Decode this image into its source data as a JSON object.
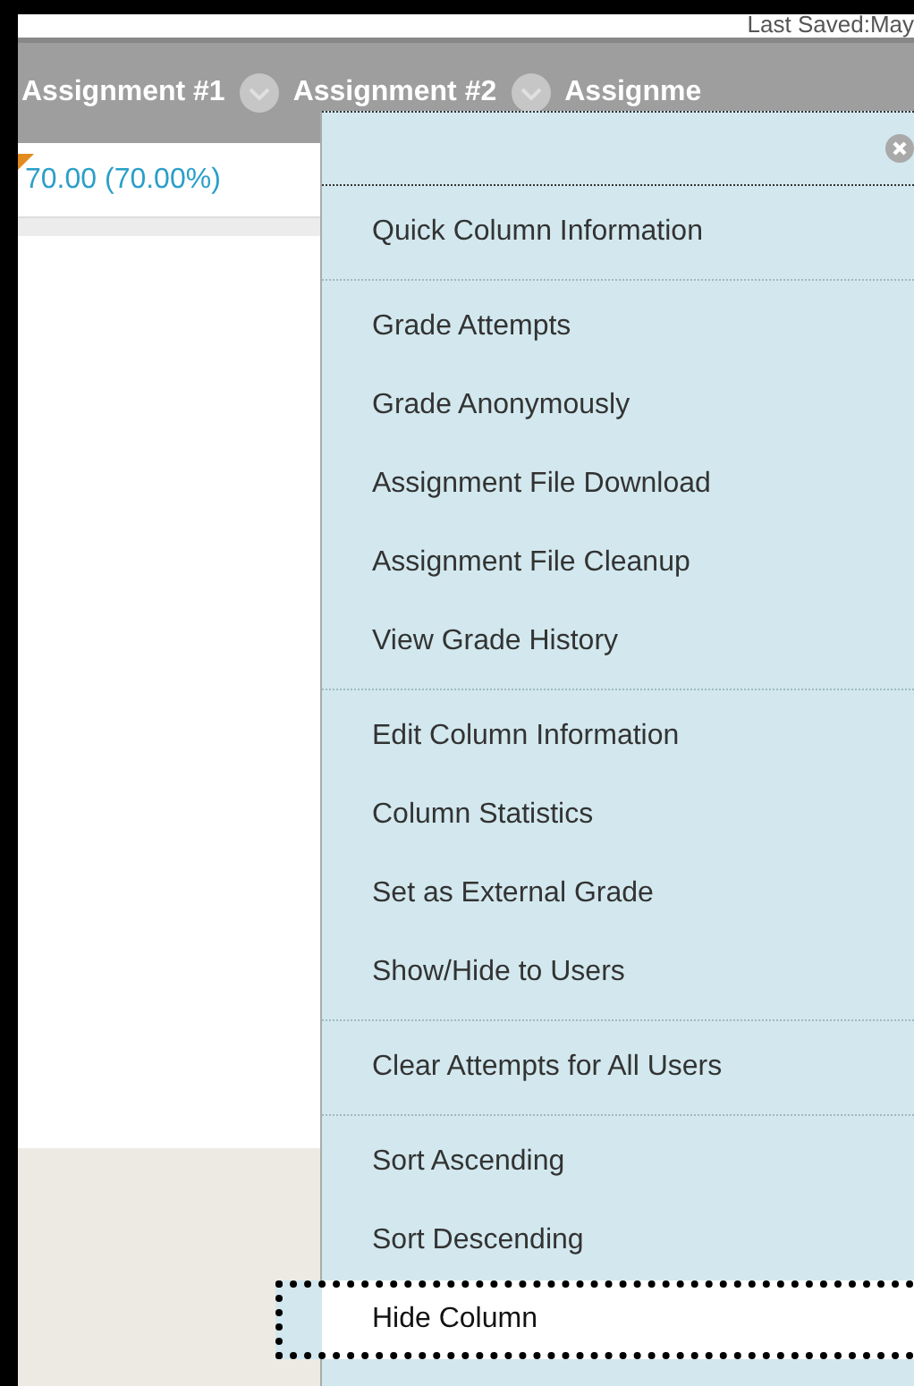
{
  "header": {
    "last_saved": "Last Saved:May"
  },
  "columns": [
    {
      "label": "Assignment #1"
    },
    {
      "label": "Assignment #2"
    },
    {
      "label": "Assignme"
    }
  ],
  "cell": {
    "value": "70.00 (70.00%)"
  },
  "menu": {
    "groups": [
      [
        {
          "label": "Quick Column Information",
          "selected": false
        }
      ],
      [
        {
          "label": "Grade Attempts",
          "selected": false
        },
        {
          "label": "Grade Anonymously",
          "selected": false
        },
        {
          "label": "Assignment File Download",
          "selected": false
        },
        {
          "label": "Assignment File Cleanup",
          "selected": false
        },
        {
          "label": "View Grade History",
          "selected": false
        }
      ],
      [
        {
          "label": "Edit Column Information",
          "selected": false
        },
        {
          "label": "Column Statistics",
          "selected": false
        },
        {
          "label": "Set as External Grade",
          "selected": false
        },
        {
          "label": "Show/Hide to Users",
          "selected": false
        }
      ],
      [
        {
          "label": "Clear Attempts for All Users",
          "selected": false
        }
      ],
      [
        {
          "label": "Sort Ascending",
          "selected": false
        },
        {
          "label": "Sort Descending",
          "selected": false
        },
        {
          "label": "Hide Column",
          "selected": true
        }
      ]
    ]
  }
}
